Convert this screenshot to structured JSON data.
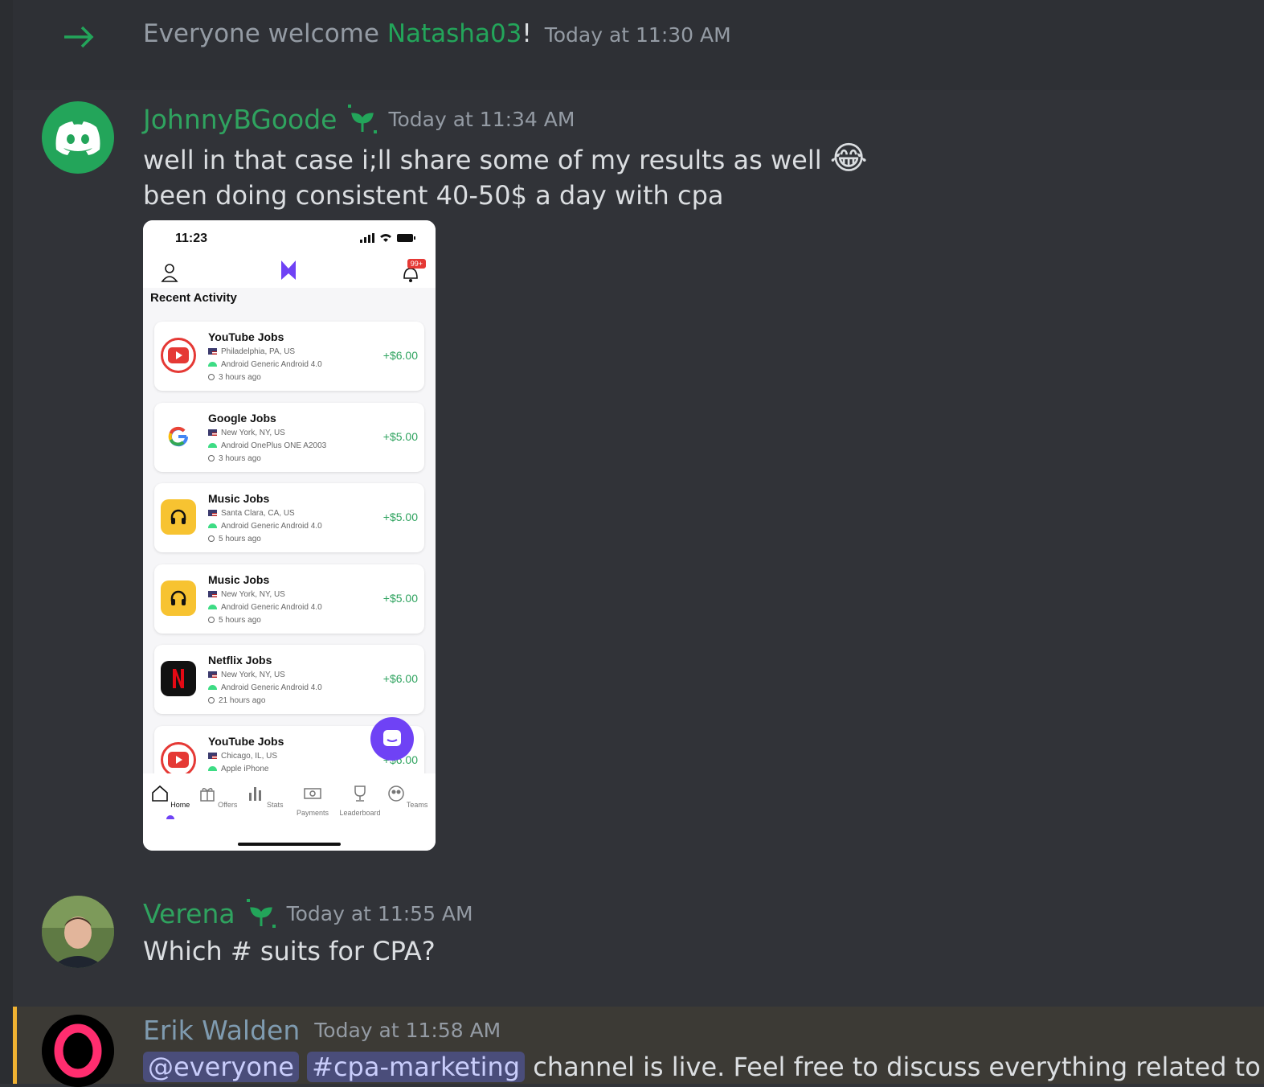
{
  "system_message": {
    "prefix": "Everyone welcome ",
    "username": "Natasha03",
    "suffix": "!",
    "timestamp": "Today at 11:30 AM"
  },
  "messages": [
    {
      "author": "JohnnyBGoode",
      "timestamp": "Today at 11:34 AM",
      "lines": [
        "well in that case i;ll share some of my results as well",
        "been doing consistent 40-50$ a day with cpa"
      ],
      "emoji": "😂",
      "screenshot": {
        "time": "11:23",
        "badge": "99+",
        "section_title": "Recent Activity",
        "items": [
          {
            "title": "YouTube Jobs",
            "location": "Philadelphia, PA, US",
            "device": "Android Generic Android 4.0",
            "ago": "3 hours ago",
            "amount": "+$6.00",
            "icon": "youtube-icon"
          },
          {
            "title": "Google Jobs",
            "location": "New York, NY, US",
            "device": "Android OnePlus ONE A2003",
            "ago": "3 hours ago",
            "amount": "+$5.00",
            "icon": "google-icon"
          },
          {
            "title": "Music Jobs",
            "location": "Santa Clara, CA, US",
            "device": "Android Generic Android 4.0",
            "ago": "5 hours ago",
            "amount": "+$5.00",
            "icon": "headphones-icon"
          },
          {
            "title": "Music Jobs",
            "location": "New York, NY, US",
            "device": "Android Generic Android 4.0",
            "ago": "5 hours ago",
            "amount": "+$5.00",
            "icon": "headphones-icon"
          },
          {
            "title": "Netflix Jobs",
            "location": "New York, NY, US",
            "device": "Android Generic Android 4.0",
            "ago": "21 hours ago",
            "amount": "+$6.00",
            "icon": "netflix-icon"
          },
          {
            "title": "YouTube Jobs",
            "location": "Chicago, IL, US",
            "device": "Apple iPhone",
            "ago": "",
            "amount": "+$6.00",
            "icon": "youtube-icon"
          }
        ],
        "tabs": [
          "Home",
          "Offers",
          "Stats",
          "Payments",
          "Leaderboard",
          "Teams"
        ]
      }
    },
    {
      "author": "Verena",
      "timestamp": "Today at 11:55 AM",
      "lines": [
        "Which # suits for CPA?"
      ]
    },
    {
      "author": "Erik Walden",
      "timestamp": "Today at 11:58 AM",
      "mention": "@everyone",
      "channel": "#cpa-marketing",
      "text": " channel is live. Feel free to discuss everything related to CPA"
    }
  ],
  "colors": {
    "background": "#313338",
    "username_green": "#2fa35f",
    "highlight_bar": "#f0b232",
    "amount_green": "#2fa35f"
  }
}
